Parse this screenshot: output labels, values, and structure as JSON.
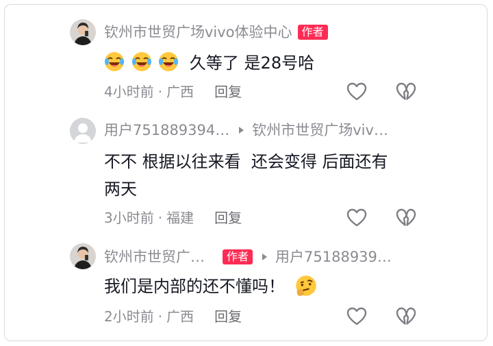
{
  "comments": [
    {
      "author": "钦州市世贸广场vivo体验中心",
      "author_badge": "作者",
      "avatar": "portrait-avatar",
      "text": "久等了 是28号哈",
      "emojis": [
        "laugh-cry-emoji",
        "laugh-cry-emoji",
        "laugh-cry-emoji"
      ],
      "time": "4小时前",
      "location": "广西",
      "reply_label": "回复",
      "separator": "·"
    },
    {
      "author": "用户751889394…",
      "reply_to": "钦州市世贸广场viv…",
      "avatar": "default-avatar",
      "text_line1": "不不 根据以往来看  还会变得 后面还有",
      "text_line2": "两天",
      "time": "3小时前",
      "location": "福建",
      "reply_label": "回复",
      "separator": "·"
    },
    {
      "author": "钦州市世贸广…",
      "author_badge": "作者",
      "reply_to": "用户75188939…",
      "avatar": "portrait-avatar",
      "text": "我们是内部的还不懂吗！",
      "emojis": [
        "thinking-emoji"
      ],
      "time": "2小时前",
      "location": "广西",
      "reply_label": "回复",
      "separator": "·"
    }
  ],
  "colors": {
    "badge": "#fe2c55",
    "meta_text": "#8a8b91",
    "body_text": "#161823",
    "icon": "#7d7e84"
  },
  "icons": [
    "heart-icon",
    "broken-heart-icon",
    "reply-arrow-icon"
  ]
}
